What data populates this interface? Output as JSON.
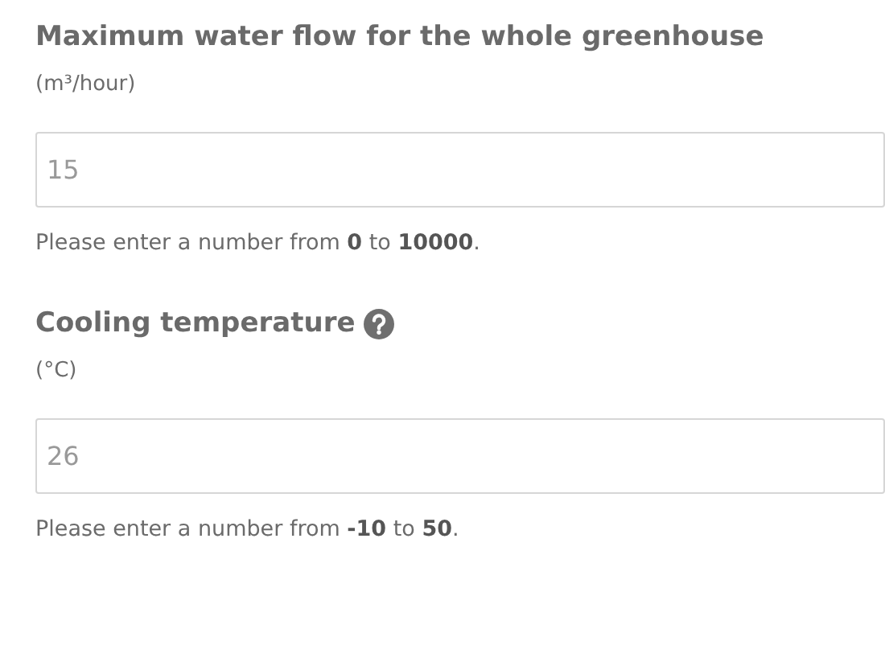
{
  "fields": [
    {
      "label": "Maximum water flow for the whole greenhouse",
      "help": false,
      "unit": "(m³/hour)",
      "placeholder": "15",
      "hint": "Please enter a number from **0** to **10000**."
    },
    {
      "label": "Cooling temperature",
      "help": true,
      "unit": "(°C)",
      "placeholder": "26",
      "hint": "Please enter a number from **-10** to **50**."
    }
  ]
}
